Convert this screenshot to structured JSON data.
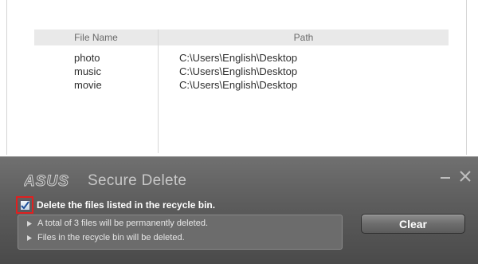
{
  "file_list": {
    "columns": [
      "File Name",
      "Path"
    ],
    "rows": [
      {
        "name": "photo",
        "path": "C:\\Users\\English\\Desktop"
      },
      {
        "name": "music",
        "path": "C:\\Users\\English\\Desktop"
      },
      {
        "name": "movie",
        "path": "C:\\Users\\English\\Desktop"
      }
    ]
  },
  "dialog": {
    "brand": "ASUS",
    "title": "Secure Delete",
    "checkbox_label": "Delete the files listed in the recycle bin.",
    "checkbox_checked": true,
    "info_lines": [
      "A total of 3 files will be permanently deleted.",
      "Files in the recycle bin will be deleted."
    ],
    "clear_label": "Clear"
  },
  "colors": {
    "dialog_bg": "#5c5c5c",
    "highlight": "#e02020"
  },
  "icons": {
    "minimize": "minimize-icon",
    "close": "close-icon",
    "check": "checkmark-icon",
    "bullet": "triangle-right-icon"
  }
}
